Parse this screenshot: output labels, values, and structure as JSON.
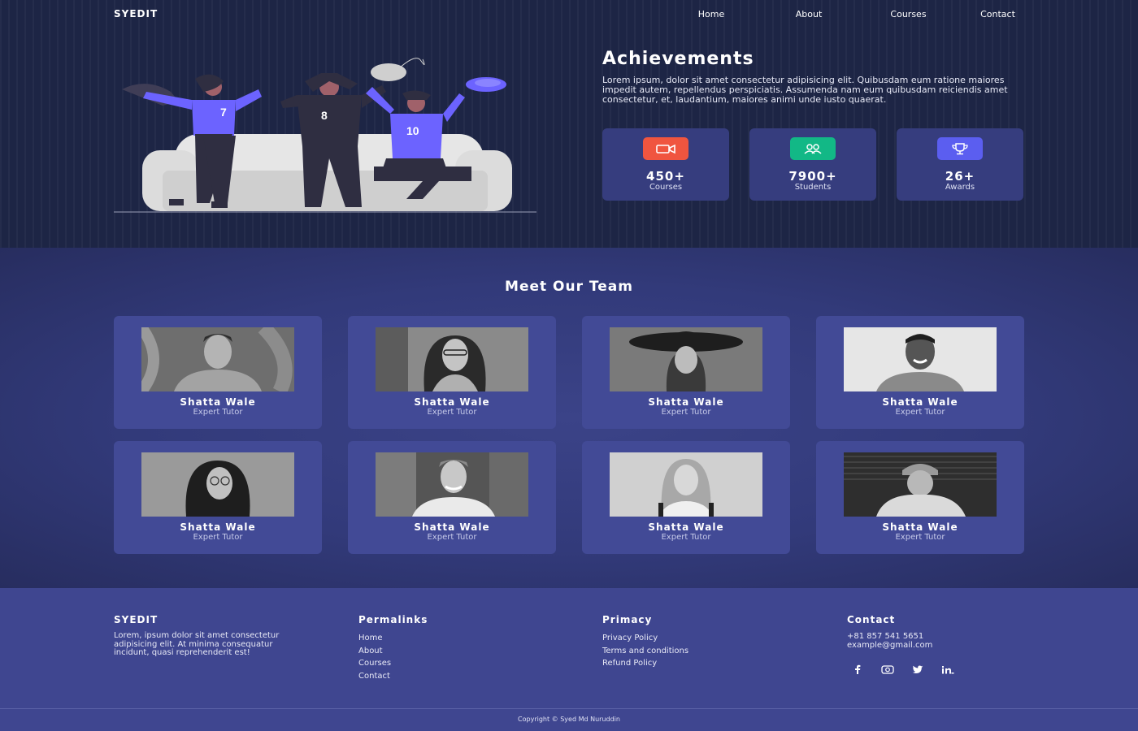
{
  "nav": {
    "logo": "SYEDIT",
    "links": [
      "Home",
      "About",
      "Courses",
      "Contact"
    ]
  },
  "achievements": {
    "title": "Achievements",
    "text": "Lorem ipsum, dolor sit amet consectetur adipisicing elit. Quibusdam eum ratione maiores impedit autem, repellendus perspiciatis. Assumenda nam eum quibusdam reiciendis amet consectetur, et, laudantium, maiores animi unde iusto quaerat.",
    "illustration_numbers": [
      "7",
      "8",
      "10"
    ],
    "stats": [
      {
        "value": "450+",
        "label": "Courses",
        "icon": "video-camera-icon",
        "color": "#f0553f"
      },
      {
        "value": "7900+",
        "label": "Students",
        "icon": "users-icon",
        "color": "#12b886"
      },
      {
        "value": "26+",
        "label": "Awards",
        "icon": "trophy-icon",
        "color": "#5b5ef0"
      }
    ]
  },
  "team": {
    "title": "Meet Our Team",
    "members": [
      {
        "name": "Shatta Wale",
        "role": "Expert Tutor"
      },
      {
        "name": "Shatta Wale",
        "role": "Expert Tutor"
      },
      {
        "name": "Shatta Wale",
        "role": "Expert Tutor"
      },
      {
        "name": "Shatta Wale",
        "role": "Expert Tutor"
      },
      {
        "name": "Shatta Wale",
        "role": "Expert Tutor"
      },
      {
        "name": "Shatta Wale",
        "role": "Expert Tutor"
      },
      {
        "name": "Shatta Wale",
        "role": "Expert Tutor"
      },
      {
        "name": "Shatta Wale",
        "role": "Expert Tutor"
      }
    ]
  },
  "footer": {
    "brand": {
      "title": "SYEDIT",
      "text": "Lorem, ipsum dolor sit amet consectetur adipisicing elit. At minima consequatur incidunt, quasi reprehenderit est!"
    },
    "permalinks": {
      "title": "Permalinks",
      "links": [
        "Home",
        "About",
        "Courses",
        "Contact"
      ]
    },
    "privacy": {
      "title": "Primacy",
      "links": [
        "Privacy Policy",
        "Terms and conditions",
        "Refund Policy"
      ]
    },
    "contact": {
      "title": "Contact",
      "phone": "+81 857 541 5651",
      "email": "example@gmail.com",
      "socials": [
        "facebook-icon",
        "instagram-icon",
        "twitter-icon",
        "linkedin-icon"
      ]
    },
    "copyright": "Copyright © Syed Md Nuruddin"
  },
  "colors": {
    "accent": "#5b5ef0",
    "card": "#424a96",
    "footer": "#3f4690"
  }
}
